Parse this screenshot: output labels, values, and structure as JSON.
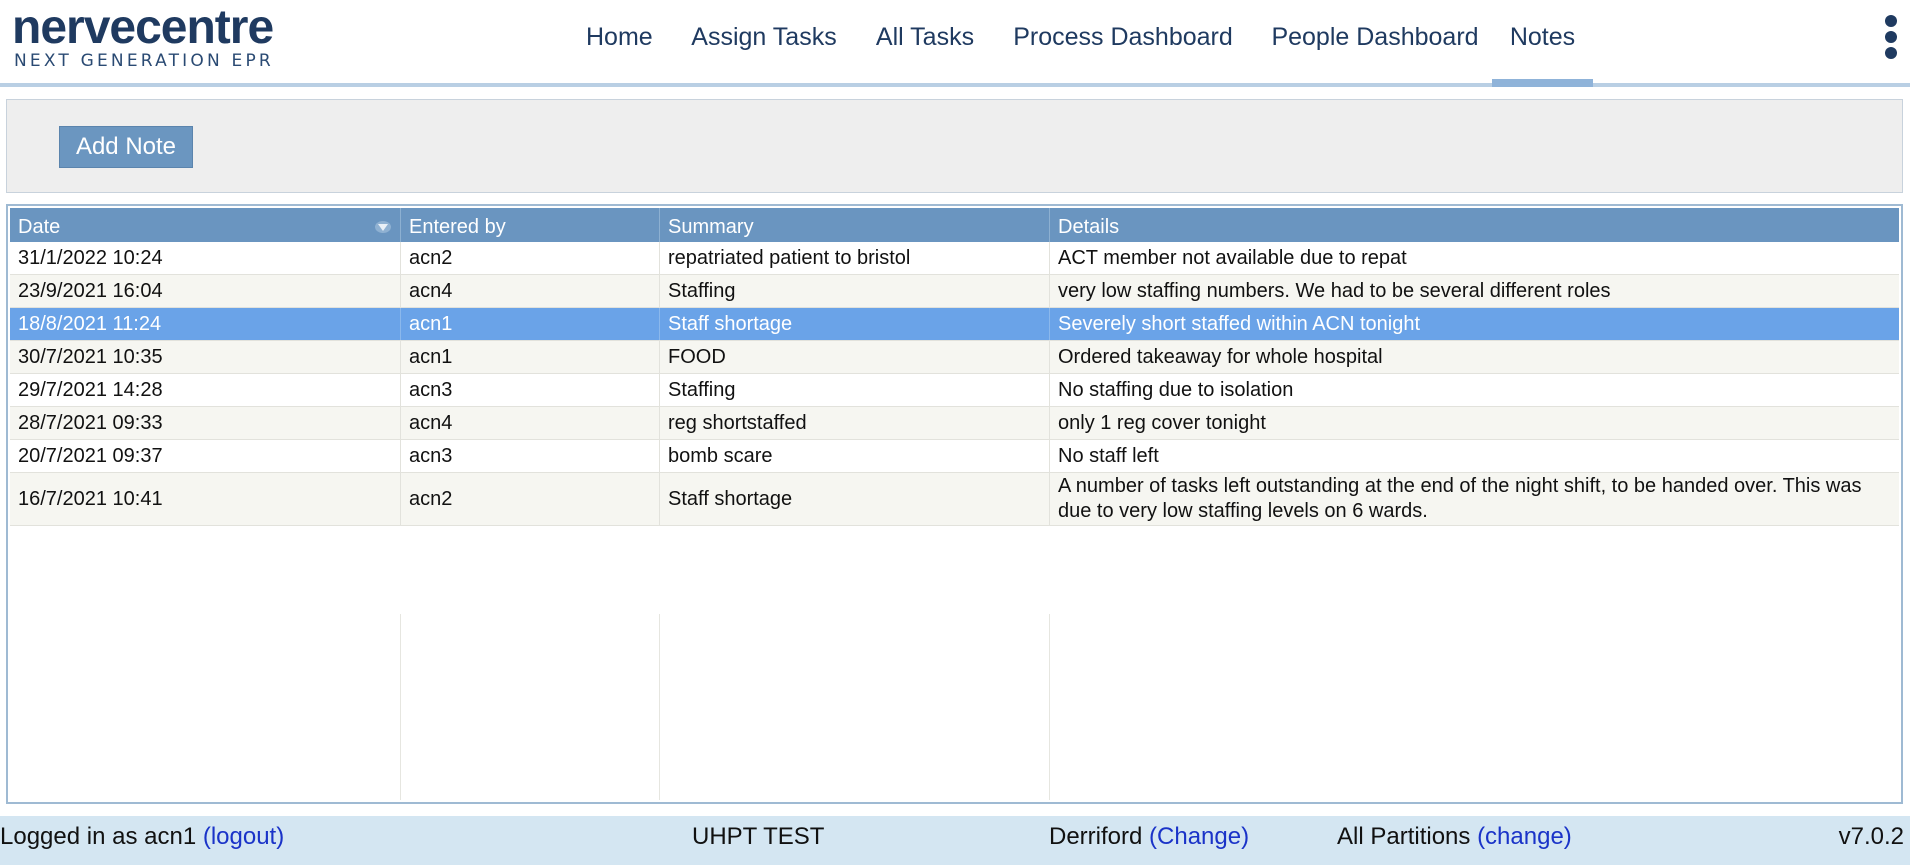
{
  "brand": {
    "name": "nervecentre",
    "tagline": "NEXT GENERATION EPR"
  },
  "nav": {
    "items": [
      {
        "label": "Home",
        "active": false
      },
      {
        "label": "Assign Tasks",
        "active": false
      },
      {
        "label": "All Tasks",
        "active": false
      },
      {
        "label": "Process Dashboard",
        "active": false
      },
      {
        "label": "People Dashboard",
        "active": false
      },
      {
        "label": "Notes",
        "active": true
      }
    ],
    "menu_icon": "kebab-vertical-icon"
  },
  "toolbar": {
    "add_note_label": "Add Note"
  },
  "notes_table": {
    "columns": [
      {
        "label": "Date",
        "sort": "descending"
      },
      {
        "label": "Entered by"
      },
      {
        "label": "Summary"
      },
      {
        "label": "Details"
      }
    ],
    "rows": [
      {
        "date": "31/1/2022 10:24",
        "entered_by": "acn2",
        "summary": "repatriated patient to bristol",
        "details": "ACT member not available due to repat",
        "selected": false
      },
      {
        "date": "23/9/2021 16:04",
        "entered_by": "acn4",
        "summary": "Staffing",
        "details": "very low staffing numbers. We had to be several different roles",
        "selected": false
      },
      {
        "date": "18/8/2021 11:24",
        "entered_by": "acn1",
        "summary": "Staff shortage",
        "details": "Severely short staffed within ACN tonight",
        "selected": true
      },
      {
        "date": "30/7/2021 10:35",
        "entered_by": "acn1",
        "summary": "FOOD",
        "details": "Ordered takeaway for whole hospital",
        "selected": false
      },
      {
        "date": "29/7/2021 14:28",
        "entered_by": "acn3",
        "summary": "Staffing",
        "details": "No staffing due to isolation",
        "selected": false
      },
      {
        "date": "28/7/2021 09:33",
        "entered_by": "acn4",
        "summary": "reg shortstaffed",
        "details": "only 1 reg cover tonight",
        "selected": false
      },
      {
        "date": "20/7/2021 09:37",
        "entered_by": "acn3",
        "summary": "bomb scare",
        "details": "No staff left",
        "selected": false
      },
      {
        "date": "16/7/2021 10:41",
        "entered_by": "acn2",
        "summary": "Staff shortage",
        "details": "A number of tasks left outstanding at the end of the night shift, to be handed over. This was due to very low staffing levels on 6 wards.",
        "selected": false
      }
    ]
  },
  "statusbar": {
    "logged_in_text": "Logged in as acn1",
    "logout_label": "(logout)",
    "environment": "UHPT TEST",
    "site": "Derriford",
    "site_change_label": "(Change)",
    "partitions": "All Partitions",
    "partitions_change_label": "(change)",
    "version": "v7.0.2"
  },
  "colors": {
    "brand_navy": "#1f3a60",
    "header_blue": "#6a95c0",
    "selected_row": "#6aa3e8",
    "status_bar": "#d4e6f2",
    "link_blue": "#1a33c8"
  }
}
